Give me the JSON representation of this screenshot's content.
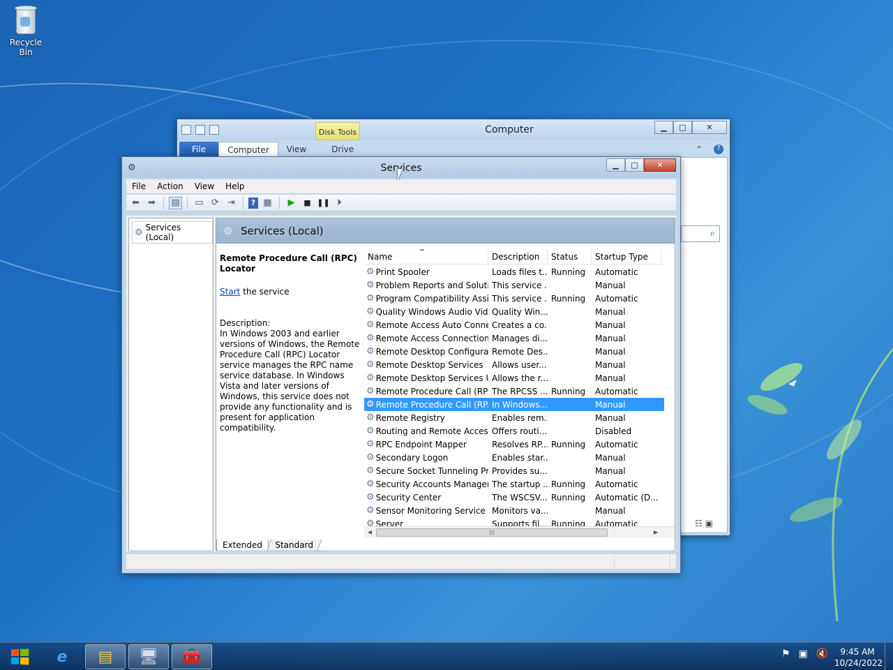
{
  "desktop": {
    "recycle_bin_label": "Recycle Bin"
  },
  "computer_window": {
    "title": "Computer",
    "contextual_tab": "Disk Tools",
    "tabs": [
      "File",
      "Computer",
      "View",
      "Drive"
    ]
  },
  "services_window": {
    "title": "Services",
    "menu": [
      "File",
      "Action",
      "View",
      "Help"
    ],
    "tree_node": "Services (Local)",
    "pane_header": "Services (Local)",
    "selected_service": {
      "name": "Remote Procedure Call (RPC) Locator",
      "start_link": "Start",
      "start_suffix": " the service",
      "description_label": "Description:",
      "description": "In Windows 2003 and earlier versions of Windows, the Remote Procedure Call (RPC) Locator service manages the RPC name service database. In Windows Vista and later versions of Windows, this service does not provide any functionality and is present for application compatibility."
    },
    "columns": [
      "Name",
      "Description",
      "Status",
      "Startup Type"
    ],
    "services": [
      {
        "name": "Print Spooler",
        "description": "Loads files t...",
        "status": "Running",
        "startup": "Automatic"
      },
      {
        "name": "Problem Reports and Soluti...",
        "description": "This service ...",
        "status": "",
        "startup": "Manual"
      },
      {
        "name": "Program Compatibility Assi...",
        "description": "This service ...",
        "status": "Running",
        "startup": "Automatic"
      },
      {
        "name": "Quality Windows Audio Vid...",
        "description": "Quality Win...",
        "status": "",
        "startup": "Manual"
      },
      {
        "name": "Remote Access Auto Conne...",
        "description": "Creates a co...",
        "status": "",
        "startup": "Manual"
      },
      {
        "name": "Remote Access Connection...",
        "description": "Manages di...",
        "status": "",
        "startup": "Manual"
      },
      {
        "name": "Remote Desktop Configurat...",
        "description": "Remote Des...",
        "status": "",
        "startup": "Manual"
      },
      {
        "name": "Remote Desktop Services",
        "description": "Allows user...",
        "status": "",
        "startup": "Manual"
      },
      {
        "name": "Remote Desktop Services U...",
        "description": "Allows the r...",
        "status": "",
        "startup": "Manual"
      },
      {
        "name": "Remote Procedure Call (RPC)",
        "description": "The RPCSS ...",
        "status": "Running",
        "startup": "Automatic"
      },
      {
        "name": "Remote Procedure Call (RP...",
        "description": "In Windows...",
        "status": "",
        "startup": "Manual"
      },
      {
        "name": "Remote Registry",
        "description": "Enables rem...",
        "status": "",
        "startup": "Manual"
      },
      {
        "name": "Routing and Remote Access",
        "description": "Offers routi...",
        "status": "",
        "startup": "Disabled"
      },
      {
        "name": "RPC Endpoint Mapper",
        "description": "Resolves RP...",
        "status": "Running",
        "startup": "Automatic"
      },
      {
        "name": "Secondary Logon",
        "description": "Enables star...",
        "status": "",
        "startup": "Manual"
      },
      {
        "name": "Secure Socket Tunneling Pr...",
        "description": "Provides su...",
        "status": "",
        "startup": "Manual"
      },
      {
        "name": "Security Accounts Manager",
        "description": "The startup ...",
        "status": "Running",
        "startup": "Automatic"
      },
      {
        "name": "Security Center",
        "description": "The WSCSV...",
        "status": "Running",
        "startup": "Automatic (D..."
      },
      {
        "name": "Sensor Monitoring Service",
        "description": "Monitors va...",
        "status": "",
        "startup": "Manual"
      },
      {
        "name": "Server",
        "description": "Supports fil...",
        "status": "Running",
        "startup": "Automatic"
      }
    ],
    "selected_index": 10,
    "view_tabs": [
      "Extended",
      "Standard"
    ]
  },
  "taskbar": {
    "time": "9:45 AM",
    "date": "10/24/2022"
  },
  "colors": {
    "selection": "#3399ff",
    "desktop": "#1e73c8"
  }
}
